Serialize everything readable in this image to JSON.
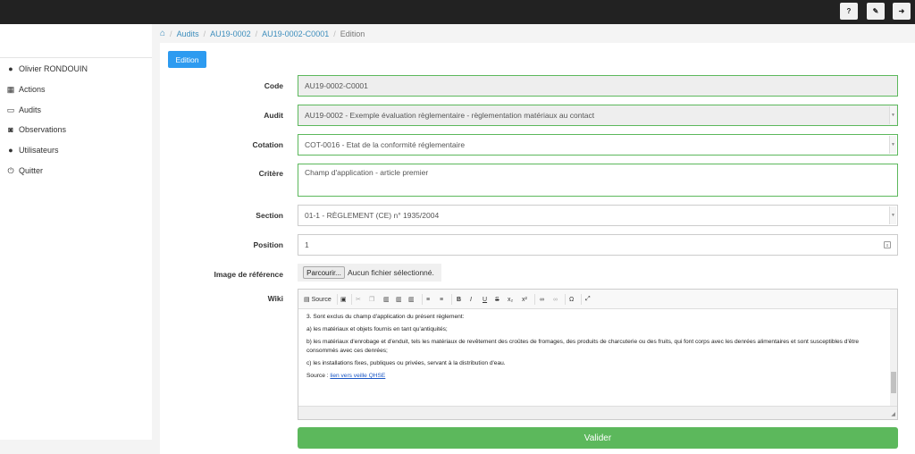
{
  "topbar": {
    "buttons": [
      {
        "name": "help-icon",
        "glyph": "?"
      },
      {
        "name": "tag-icon",
        "glyph": "✎"
      },
      {
        "name": "logout-icon",
        "glyph": "➜"
      }
    ]
  },
  "sidebar": {
    "items": [
      {
        "label": "Olivier RONDOUIN",
        "icon": "user-icon",
        "glyph": "●"
      },
      {
        "label": "Actions",
        "icon": "calendar-icon",
        "glyph": "▦"
      },
      {
        "label": "Audits",
        "icon": "monitor-icon",
        "glyph": "▭"
      },
      {
        "label": "Observations",
        "icon": "camera-icon",
        "glyph": "◙"
      },
      {
        "label": "Utilisateurs",
        "icon": "users-icon",
        "glyph": "●"
      },
      {
        "label": "Quitter",
        "icon": "power-icon",
        "glyph": "⏻"
      }
    ]
  },
  "breadcrumb": {
    "home_glyph": "⌂",
    "items": [
      "Audits",
      "AU19-0002",
      "AU19-0002-C0001"
    ],
    "current": "Edition"
  },
  "tab": {
    "label": "Edition"
  },
  "form": {
    "code": {
      "label": "Code",
      "value": "AU19-0002-C0001"
    },
    "audit": {
      "label": "Audit",
      "value": "AU19-0002 - Exemple évaluation règlementaire - règlementation matériaux au contact"
    },
    "cotation": {
      "label": "Cotation",
      "value": "COT-0016 - Etat de la conformité réglementaire"
    },
    "critere": {
      "label": "Critère",
      "value": "Champ d'application - article premier"
    },
    "section": {
      "label": "Section",
      "value": "01-1 - RÈGLEMENT (CE) n° 1935/2004"
    },
    "position": {
      "label": "Position",
      "value": "1"
    },
    "image": {
      "label": "Image de référence",
      "button": "Parcourir...",
      "status": "Aucun fichier sélectionné."
    },
    "wiki": {
      "label": "Wiki",
      "source_label": "Source"
    }
  },
  "editor": {
    "paragraphs": [
      "3.   Sont exclus du champ d'application du présent règlement:",
      "a) les matériaux et objets fournis en tant qu'antiquités;",
      "b) les matériaux d'enrobage et d'enduit, tels les matériaux de revêtement des croûtes de fromages, des produits de charcuterie ou des fruits, qui font corps avec les denrées alimentaires et sont susceptibles d'être consommés avec ces denrées;",
      "c) les installations fixes, publiques ou privées, servant à la distribution d'eau."
    ],
    "source_prefix": "Source : ",
    "source_link": "lien vers veille QHSE"
  },
  "submit": {
    "label": "Valider"
  },
  "colors": {
    "primary": "#2d9bf0",
    "success": "#5cb85c",
    "link": "#3c8dbc",
    "topbar": "#222222"
  }
}
